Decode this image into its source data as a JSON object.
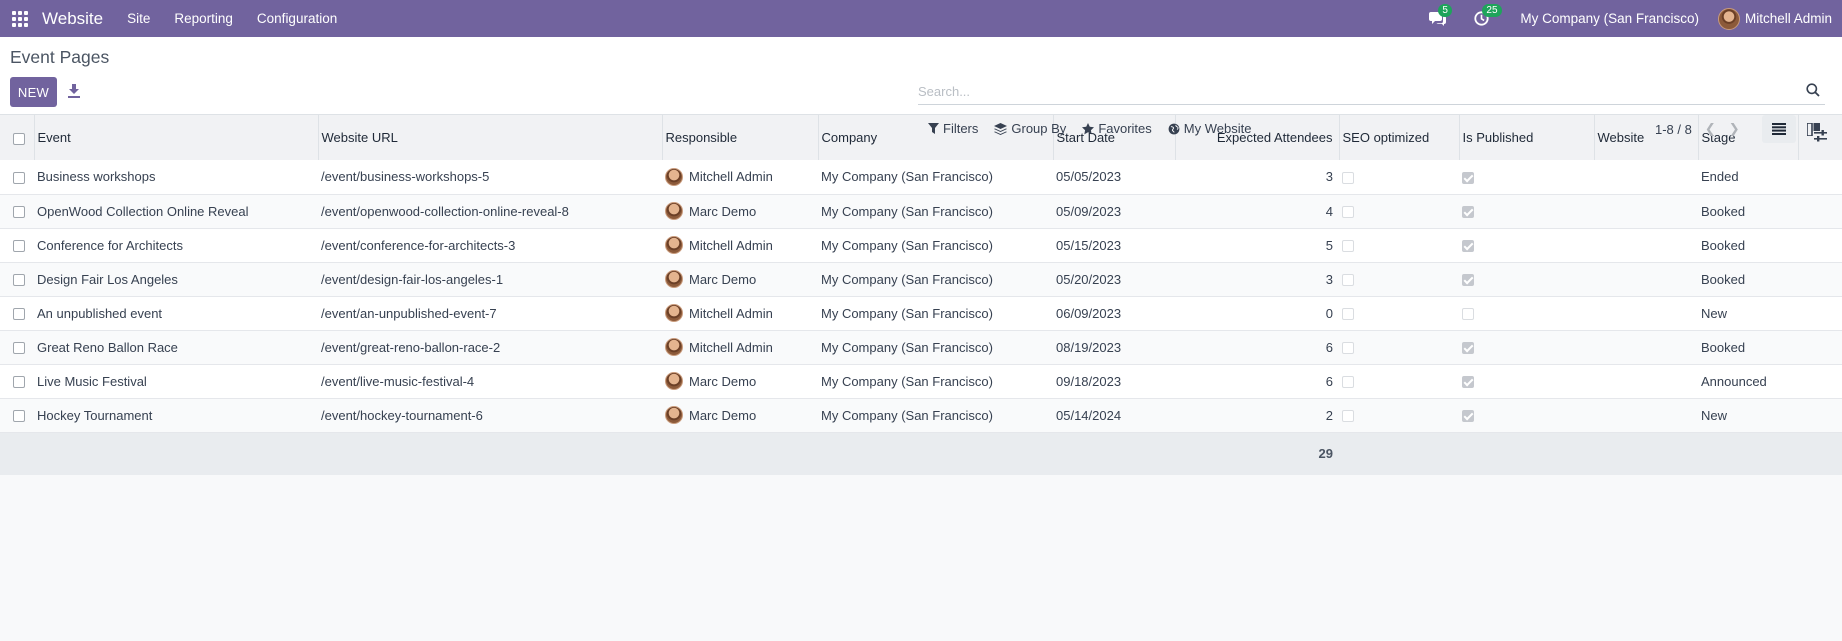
{
  "navbar": {
    "brand": "Website",
    "menu": [
      "Site",
      "Reporting",
      "Configuration"
    ],
    "messages_count": "5",
    "activities_count": "25",
    "company": "My Company (San Francisco)",
    "user": "Mitchell Admin",
    "bg_color": "#71639e"
  },
  "control": {
    "title": "Event Pages",
    "new_label": "NEW",
    "search_placeholder": "Search...",
    "filters_label": "Filters",
    "group_by_label": "Group By",
    "favorites_label": "Favorites",
    "my_website_label": "My Website",
    "pager": "1-8 / 8"
  },
  "table": {
    "headers": {
      "event": "Event",
      "url": "Website URL",
      "responsible": "Responsible",
      "company": "Company",
      "start_date": "Start Date",
      "attendees": "Expected Attendees",
      "seo": "SEO optimized",
      "published": "Is Published",
      "website": "Website",
      "stage": "Stage"
    },
    "rows": [
      {
        "event": "Business workshops",
        "url": "/event/business-workshops-5",
        "responsible": "Mitchell Admin",
        "company": "My Company (San Francisco)",
        "start_date": "05/05/2023",
        "attendees": "3",
        "seo": false,
        "published": true,
        "website": "",
        "stage": "Ended"
      },
      {
        "event": "OpenWood Collection Online Reveal",
        "url": "/event/openwood-collection-online-reveal-8",
        "responsible": "Marc Demo",
        "company": "My Company (San Francisco)",
        "start_date": "05/09/2023",
        "attendees": "4",
        "seo": false,
        "published": true,
        "website": "",
        "stage": "Booked"
      },
      {
        "event": "Conference for Architects",
        "url": "/event/conference-for-architects-3",
        "responsible": "Mitchell Admin",
        "company": "My Company (San Francisco)",
        "start_date": "05/15/2023",
        "attendees": "5",
        "seo": false,
        "published": true,
        "website": "",
        "stage": "Booked"
      },
      {
        "event": "Design Fair Los Angeles",
        "url": "/event/design-fair-los-angeles-1",
        "responsible": "Marc Demo",
        "company": "My Company (San Francisco)",
        "start_date": "05/20/2023",
        "attendees": "3",
        "seo": false,
        "published": true,
        "website": "",
        "stage": "Booked"
      },
      {
        "event": "An unpublished event",
        "url": "/event/an-unpublished-event-7",
        "responsible": "Mitchell Admin",
        "company": "My Company (San Francisco)",
        "start_date": "06/09/2023",
        "attendees": "0",
        "seo": false,
        "published": false,
        "website": "",
        "stage": "New"
      },
      {
        "event": "Great Reno Ballon Race",
        "url": "/event/great-reno-ballon-race-2",
        "responsible": "Mitchell Admin",
        "company": "My Company (San Francisco)",
        "start_date": "08/19/2023",
        "attendees": "6",
        "seo": false,
        "published": true,
        "website": "",
        "stage": "Booked"
      },
      {
        "event": "Live Music Festival",
        "url": "/event/live-music-festival-4",
        "responsible": "Marc Demo",
        "company": "My Company (San Francisco)",
        "start_date": "09/18/2023",
        "attendees": "6",
        "seo": false,
        "published": true,
        "website": "",
        "stage": "Announced"
      },
      {
        "event": "Hockey Tournament",
        "url": "/event/hockey-tournament-6",
        "responsible": "Marc Demo",
        "company": "My Company (San Francisco)",
        "start_date": "05/14/2024",
        "attendees": "2",
        "seo": false,
        "published": true,
        "website": "",
        "stage": "New"
      }
    ],
    "total_attendees": "29"
  }
}
